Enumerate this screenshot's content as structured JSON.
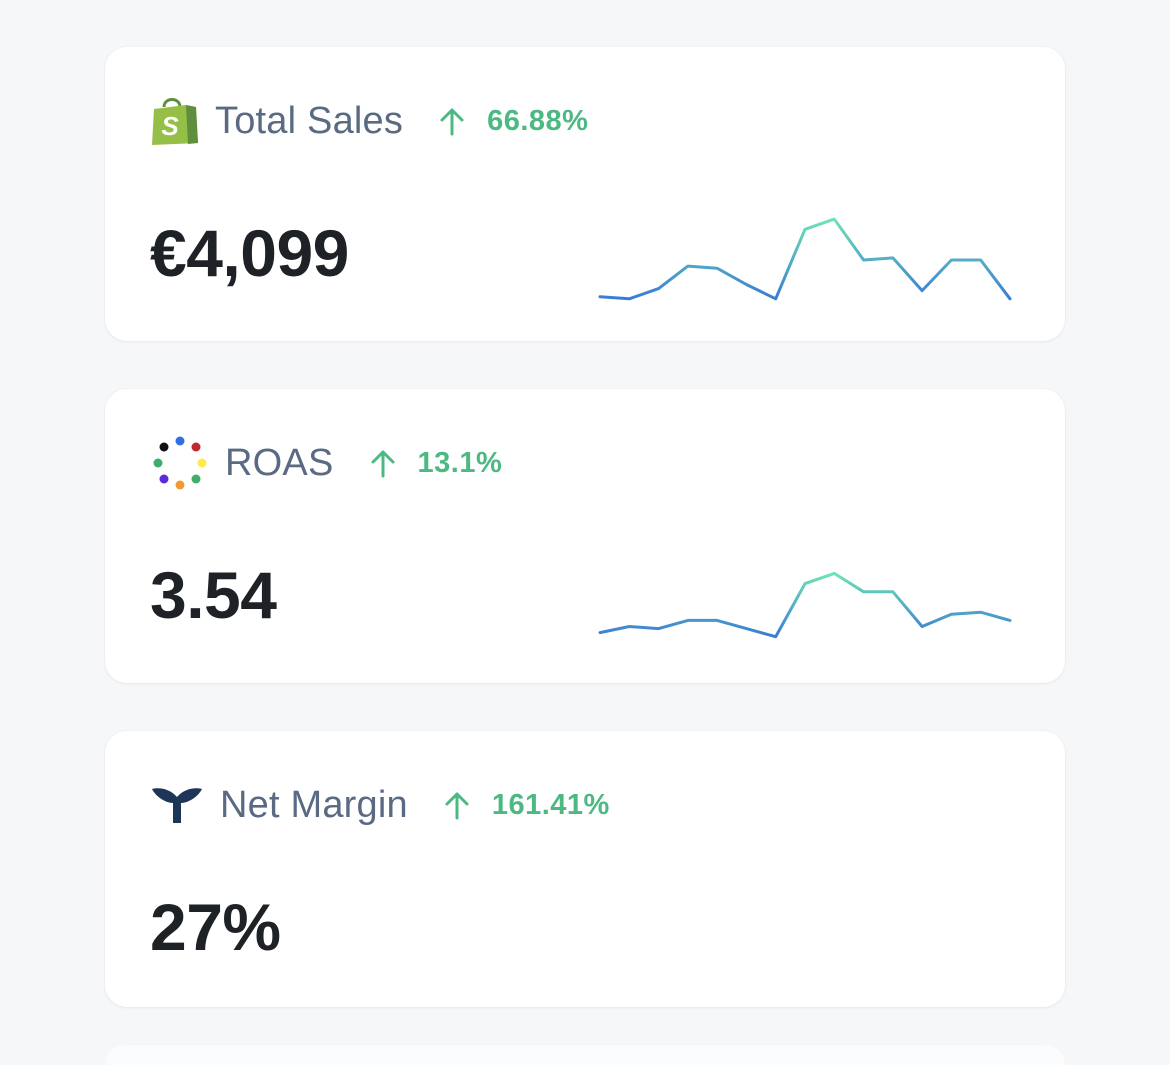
{
  "cards": [
    {
      "title": "Total Sales",
      "change": "66.88%",
      "value": "€4,099",
      "icon": "shopify-bag-icon"
    },
    {
      "title": "ROAS",
      "change": "13.1%",
      "value": "3.54",
      "icon": "multicolor-dots-icon"
    },
    {
      "title": "Net Margin",
      "change": "161.41%",
      "value": "27%",
      "icon": "whale-tail-icon"
    }
  ],
  "colors": {
    "positive": "#4cb882",
    "title": "#5a6a83",
    "value": "#1e2227",
    "spark_low": "#3a7bd5",
    "spark_high": "#6fe3b4"
  },
  "chart_data": [
    {
      "type": "line",
      "series": [
        {
          "values": [
            5,
            4,
            9,
            20,
            19,
            11,
            4,
            38,
            43,
            23,
            24,
            8,
            23,
            23,
            4
          ]
        }
      ]
    },
    {
      "type": "line",
      "series": [
        {
          "values": [
            8,
            11,
            10,
            14,
            14,
            10,
            6,
            32,
            37,
            28,
            28,
            11,
            17,
            18,
            14
          ]
        }
      ]
    }
  ]
}
